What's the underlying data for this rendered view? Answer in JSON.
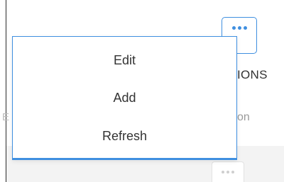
{
  "toolbar": {
    "more_button_icon": "more-horizontal-icon"
  },
  "table": {
    "header_partial": "IONS",
    "subheader_partial": "on",
    "left_hint": "E"
  },
  "row": {
    "more_button_icon": "more-horizontal-icon"
  },
  "menu": {
    "items": [
      {
        "label": "Edit"
      },
      {
        "label": "Add"
      },
      {
        "label": "Refresh"
      }
    ]
  },
  "colors": {
    "accent": "#3f8fe0",
    "text": "#333333",
    "muted": "#9a9a9a"
  }
}
